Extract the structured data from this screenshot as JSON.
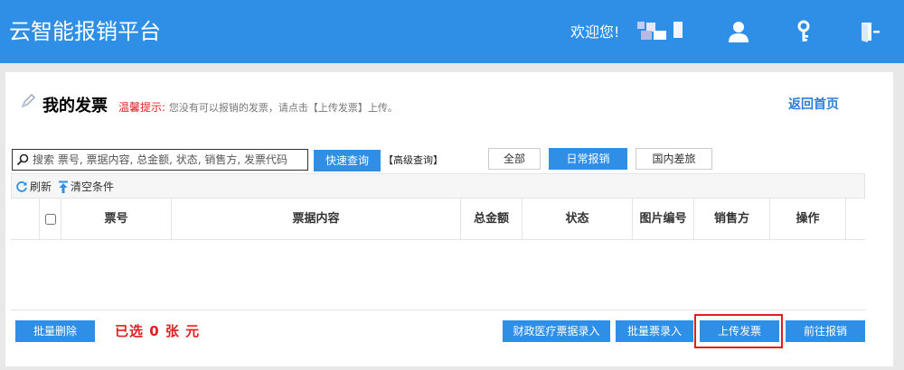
{
  "header": {
    "brand": "云智能报销平台",
    "welcome": "欢迎您!",
    "icons": [
      "user-icon",
      "key-icon",
      "logout-icon"
    ]
  },
  "page": {
    "title": "我的发票",
    "hint_label": "温馨提示:",
    "hint_text": "您没有可以报销的发票，请点击【上传发票】上传。",
    "back_link": "返回首页"
  },
  "search": {
    "placeholder": "搜索 票号, 票据内容, 总金额, 状态, 销售方, 发票代码",
    "quick_button": "快速查询",
    "advanced": "【高级查询】"
  },
  "filters": [
    {
      "label": "全部",
      "active": false
    },
    {
      "label": "日常报销",
      "active": true
    },
    {
      "label": "国内差旅",
      "active": false
    }
  ],
  "toolbar": {
    "refresh": "刷新",
    "clear": "清空条件"
  },
  "table": {
    "columns": [
      "票号",
      "票据内容",
      "总金额",
      "状态",
      "图片编号",
      "销售方",
      "操作"
    ],
    "rows": []
  },
  "footer": {
    "batch_delete": "批量删除",
    "selected_text": "已选 0 张 元",
    "finance_medical": "财政医疗票据录入",
    "batch_entry": "批量票录入",
    "upload": "上传发票",
    "go_reimburse": "前往报销"
  },
  "colors": {
    "primary": "#2f8ee5",
    "alert": "#e02020"
  }
}
